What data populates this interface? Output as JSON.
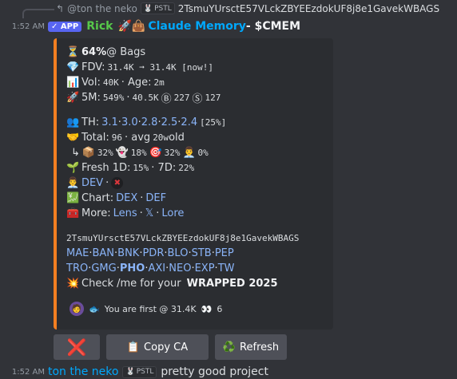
{
  "reply": {
    "arrow": "↰",
    "username": "@ton the neko",
    "tag": "PSTL",
    "message": "2TsmuYUrsctE57VLckZBYEEzdokUF8j8e1GavekWBAGS"
  },
  "message": {
    "timestamp": "1:52 AM",
    "app_badge": "✓ APP",
    "author": "Rick",
    "title_emoji": "🚀👜",
    "title_link": "Claude Memory",
    "title_suffix": " - $CMEM"
  },
  "embed": {
    "bags": {
      "emoji": "⏳",
      "pct": "64%",
      "label": " @ Bags"
    },
    "fdv": {
      "emoji": "💎",
      "label": "FDV:",
      "value": "31.4K ➞ 31.4K [now!]"
    },
    "vol": {
      "emoji": "📊",
      "label": "Vol:",
      "vol_value": "40K",
      "sep": " · Age: ",
      "age_value": "2m"
    },
    "five_m": {
      "emoji": "🚀",
      "label": "5M:",
      "pct": "549%",
      "sep": "·",
      "value": "40.5K",
      "b_icon": "Ⓑ",
      "b_count": "227",
      "s_icon": "Ⓢ",
      "s_count": "127"
    },
    "th": {
      "emoji": "👥",
      "label": "TH:",
      "links": [
        "3.1",
        "3.0",
        "2.8",
        "2.5",
        "2.4"
      ],
      "tail": "[25%]"
    },
    "total": {
      "emoji": "🤝",
      "label": "Total:",
      "count": "96",
      "sep": " · avg ",
      "age": "20w",
      "tail": " old"
    },
    "breakdown": {
      "arrow": "↳",
      "e1": "📦",
      "v1": "32%",
      "e2": "👻",
      "v2": "18%",
      "e3": "🎯",
      "v3": "32%",
      "e4": "👨‍💼",
      "v4": "0%"
    },
    "fresh": {
      "emoji": "🌱",
      "label": "Fresh 1D:",
      "v1d": "15%",
      "sep": " · 7D: ",
      "v7d": "22%"
    },
    "dev": {
      "emoji": "👨‍💼",
      "link": "DEV",
      "sep": " · ",
      "status": "✖"
    },
    "chart": {
      "emoji": "💹",
      "label": "Chart:",
      "link1": "DEX",
      "sep": " · ",
      "link2": "DEF"
    },
    "more": {
      "emoji": "🧰",
      "label": "More:",
      "link1": "Lens",
      "sep1": " · ",
      "link2": "𝕏",
      "sep2": " · ",
      "link3": "Lore"
    },
    "address": "2TsmuYUrsctE57VLckZBYEEzdokUF8j8e1GavekWBAGS",
    "platforms1": [
      "MAE",
      "BAN",
      "BNK",
      "PDR",
      "BLO",
      "STB",
      "PEP"
    ],
    "platforms2": [
      "TRO",
      "GMG",
      "PHO",
      "AXI",
      "NEO",
      "EXP",
      "TW"
    ],
    "wrapped": {
      "emoji": "💥",
      "text": "Check /me for your ",
      "bold": "WRAPPED 2025"
    },
    "footer": {
      "avatar": "🧑",
      "emoji": "🐟",
      "text": "You are first @ 31.4K",
      "icon": "👀",
      "count": "6"
    }
  },
  "buttons": {
    "dismiss": "❌",
    "copy_icon": "📋",
    "copy_label": "Copy CA",
    "refresh_icon": "♻️",
    "refresh_label": "Refresh"
  },
  "bottom": {
    "timestamp": "1:52 AM",
    "username": "ton the neko",
    "tag": "PSTL",
    "message": "pretty good project"
  }
}
